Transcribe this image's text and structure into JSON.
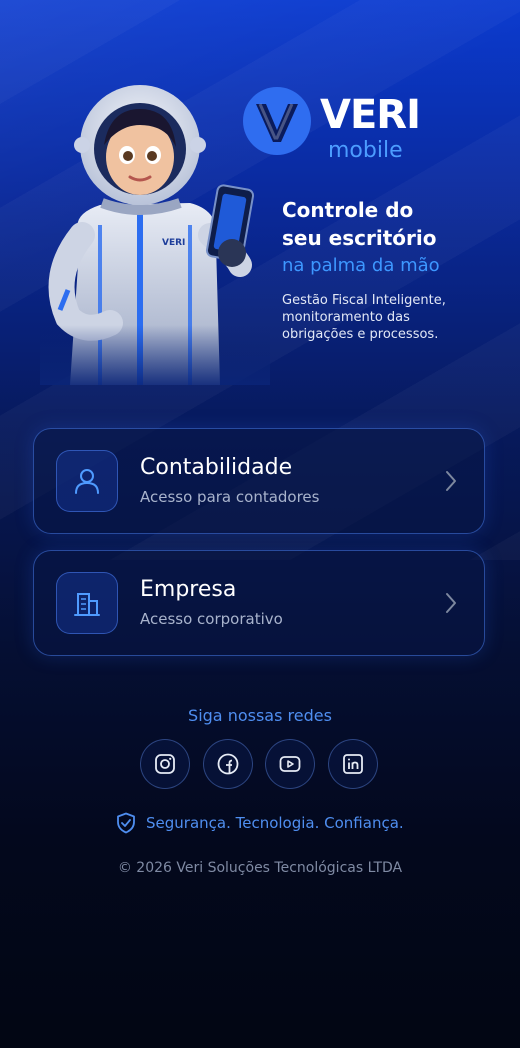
{
  "brand": {
    "name": "VERI",
    "sub": "mobile",
    "colors": {
      "accent": "#3d97ff",
      "logo_blue": "#2f6df0",
      "background_top": "#0b3bd0",
      "background_bottom": "#020613"
    }
  },
  "hero": {
    "headline_line1": "Controle do",
    "headline_line2": "seu escritório",
    "headline_line3": "na palma da mão",
    "tagline_line1": "Gestão Fiscal Inteligente,",
    "tagline_line2": "monitoramento das",
    "tagline_line3": "obrigações e processos.",
    "mascot_icon": "astronaut-mascot-icon",
    "suit_badge": "VERI"
  },
  "cards": [
    {
      "title": "Contabilidade",
      "subtitle": "Acesso para contadores",
      "icon": "user-icon"
    },
    {
      "title": "Empresa",
      "subtitle": "Acesso corporativo",
      "icon": "building-icon"
    }
  ],
  "social": {
    "label": "Siga nossas redes",
    "items": [
      {
        "icon": "instagram-icon"
      },
      {
        "icon": "facebook-icon"
      },
      {
        "icon": "youtube-icon"
      },
      {
        "icon": "linkedin-icon"
      }
    ]
  },
  "footer": {
    "motto": "Segurança. Tecnologia. Confiança.",
    "motto_icon": "shield-check-icon",
    "copyright": "© 2026 Veri Soluções Tecnológicas LTDA"
  }
}
